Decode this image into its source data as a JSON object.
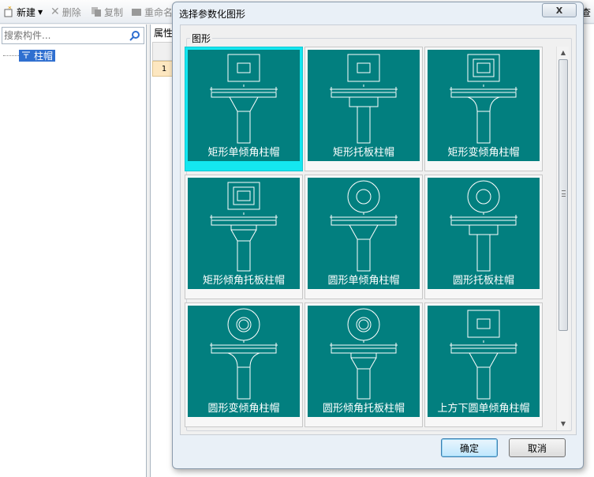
{
  "toolbar": {
    "new_label": "新建",
    "delete_label": "删除",
    "copy_label": "复制",
    "rename_label": "重命名",
    "right_edge": "查"
  },
  "left_pane": {
    "search_placeholder": "搜索构件...",
    "tree_item": "柱帽"
  },
  "right_pane": {
    "tab_label": "属性",
    "row_number": "1"
  },
  "dialog": {
    "title": "选择参数化图形",
    "close_label": "X",
    "group_label": "图形",
    "ok_label": "确定",
    "cancel_label": "取消",
    "tiles": [
      {
        "label": "矩形单倾角柱帽",
        "top": "rect",
        "cap": "slope"
      },
      {
        "label": "矩形托板柱帽",
        "top": "rect",
        "cap": "plate"
      },
      {
        "label": "矩形变倾角柱帽",
        "top": "rect2",
        "cap": "curve"
      },
      {
        "label": "矩形倾角托板柱帽",
        "top": "rect2",
        "cap": "slopeplate"
      },
      {
        "label": "圆形单倾角柱帽",
        "top": "circle",
        "cap": "slope"
      },
      {
        "label": "圆形托板柱帽",
        "top": "circle",
        "cap": "plate"
      },
      {
        "label": "圆形变倾角柱帽",
        "top": "circle2",
        "cap": "curve"
      },
      {
        "label": "圆形倾角托板柱帽",
        "top": "circle2",
        "cap": "slopeplate"
      },
      {
        "label": "上方下圆单倾角柱帽",
        "top": "rect",
        "cap": "slope"
      }
    ]
  },
  "colors": {
    "tile_bg": "#027f7f",
    "selected": "#14e7f0"
  }
}
